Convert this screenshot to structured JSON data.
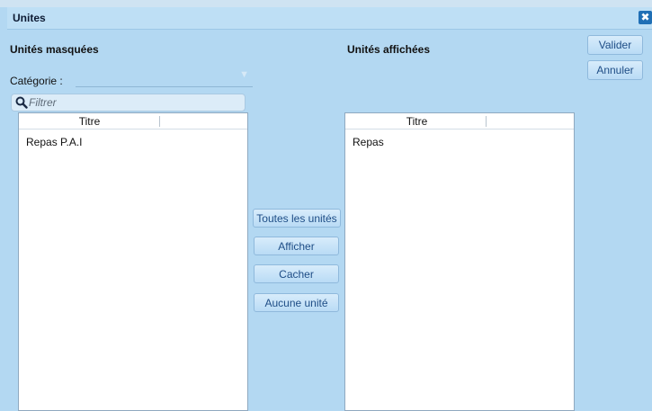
{
  "window": {
    "title": "Unites",
    "close_icon": "close-icon"
  },
  "hidden_panel": {
    "heading": "Unités masquées",
    "category_label": "Catégorie :",
    "category_value": "",
    "filter_placeholder": "Filtrer",
    "column_title": "Titre",
    "items": [
      "Repas P.A.I"
    ]
  },
  "shown_panel": {
    "heading": "Unités affichées",
    "column_title": "Titre",
    "items": [
      "Repas"
    ]
  },
  "transfer_buttons": {
    "all": "Toutes les unités",
    "show": "Afficher",
    "hide": "Cacher",
    "none": "Aucune unité"
  },
  "actions": {
    "validate": "Valider",
    "cancel": "Annuler"
  },
  "colors": {
    "background": "#b3d8f2",
    "button_text": "#1e4d86",
    "close_bg": "#1f6fb5"
  }
}
